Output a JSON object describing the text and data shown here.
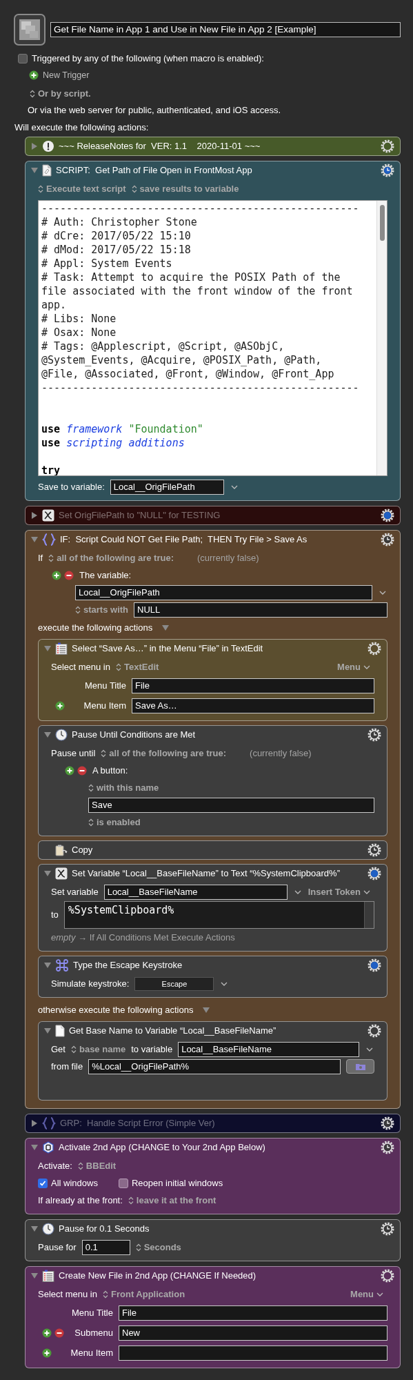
{
  "macro": {
    "title": "Get File Name in App 1 and Use in New File in App 2 [Example]"
  },
  "triggers": {
    "enabled": false,
    "label": "Triggered by any of the following (when macro is enabled):",
    "new_trigger": "New Trigger",
    "script_popup": "Or by script.",
    "web_note": "Or via the web server for public, authenticated, and iOS access."
  },
  "actions_heading": "Will execute the following actions:",
  "actions": [
    {
      "kind": "comment",
      "title": "~~~ ReleaseNotes for  VER: 1.1    2020-11-01 ~~~",
      "color": "#475a29",
      "timeout": false,
      "notify": false,
      "expanded": false,
      "disabled": false
    },
    {
      "kind": "script",
      "title": "SCRIPT:  Get Path of File Open in FrontMost App",
      "color": "#30515a",
      "timeout": true,
      "notify": true,
      "expanded": true,
      "disabled": false,
      "rows": [
        {
          "kind": "line",
          "items": [
            {
              "kind": "popup",
              "text": "Execute text script"
            },
            {
              "kind": "popup",
              "text": "save results to variable"
            }
          ]
        },
        {
          "kind": "code",
          "lines": [
            {
              "kind": "text",
              "tokens": [
                {
                  "kind": "comment",
                  "text": "---------------------------------------------------"
                }
              ]
            },
            {
              "kind": "text",
              "tokens": [
                {
                  "kind": "comment",
                  "text": "# Auth: Christopher Stone"
                }
              ]
            },
            {
              "kind": "text",
              "tokens": [
                {
                  "kind": "comment",
                  "text": "# dCre: 2017/05/22 15:10"
                }
              ]
            },
            {
              "kind": "text",
              "tokens": [
                {
                  "kind": "comment",
                  "text": "# dMod: 2017/05/22 15:18"
                }
              ]
            },
            {
              "kind": "text",
              "tokens": [
                {
                  "kind": "comment",
                  "text": "# Appl: System Events"
                }
              ]
            },
            {
              "kind": "text",
              "tokens": [
                {
                  "kind": "comment",
                  "text": "# Task: Attempt to acquire the POSIX Path of the"
                }
              ]
            },
            {
              "kind": "text",
              "tokens": [
                {
                  "kind": "comment",
                  "text": "file associated with the front window of the front"
                }
              ]
            },
            {
              "kind": "text",
              "tokens": [
                {
                  "kind": "comment",
                  "text": "app."
                }
              ]
            },
            {
              "kind": "text",
              "tokens": [
                {
                  "kind": "comment",
                  "text": "# Libs: None"
                }
              ]
            },
            {
              "kind": "text",
              "tokens": [
                {
                  "kind": "comment",
                  "text": "# Osax: None"
                }
              ]
            },
            {
              "kind": "text",
              "tokens": [
                {
                  "kind": "comment",
                  "text": "# Tags: @Applescript, @Script, @ASObjC,"
                }
              ]
            },
            {
              "kind": "text",
              "tokens": [
                {
                  "kind": "comment",
                  "text": "@System_Events, @Acquire, @POSIX_Path, @Path,"
                }
              ]
            },
            {
              "kind": "text",
              "tokens": [
                {
                  "kind": "comment",
                  "text": "@File, @Associated, @Front, @Window, @Front_App"
                }
              ]
            },
            {
              "kind": "text",
              "tokens": [
                {
                  "kind": "comment",
                  "text": "---------------------------------------------------"
                }
              ]
            },
            {
              "kind": "blank"
            },
            {
              "kind": "blank"
            },
            {
              "kind": "text",
              "tokens": [
                {
                  "kind": "keyword",
                  "text": "use "
                },
                {
                  "kind": "term",
                  "text": "framework "
                },
                {
                  "kind": "string",
                  "text": "\"Foundation\""
                }
              ]
            },
            {
              "kind": "text",
              "tokens": [
                {
                  "kind": "keyword",
                  "text": "use "
                },
                {
                  "kind": "term",
                  "text": "scripting additions"
                }
              ]
            },
            {
              "kind": "blank"
            },
            {
              "kind": "text",
              "tokens": [
                {
                  "kind": "keyword",
                  "text": "try"
                }
              ]
            }
          ]
        },
        {
          "kind": "line",
          "items": [
            {
              "kind": "text",
              "text": "Save to variable:"
            },
            {
              "kind": "short_field",
              "value": "Local__OrigFilePath",
              "menu": true
            }
          ]
        }
      ]
    },
    {
      "kind": "set_variable",
      "title": "Set OrigFilePath to \"NULL\" for TESTING",
      "color": "#2a0c0c",
      "timeout": false,
      "notify": true,
      "expanded": false,
      "disabled": true
    },
    {
      "kind": "if",
      "title": "IF:  Script Could NOT Get File Path;  THEN Try File > Save As",
      "color": "#5c442d",
      "timeout": true,
      "notify": false,
      "expanded": true,
      "disabled": false,
      "rows": [
        {
          "kind": "line",
          "items": [
            {
              "kind": "text",
              "text": "If"
            },
            {
              "kind": "popup",
              "text": "all of the following are true:"
            },
            {
              "kind": "note",
              "text": "(currently false)"
            }
          ]
        },
        {
          "kind": "sub",
          "items": [
            {
              "kind": "addremove"
            },
            {
              "kind": "text",
              "text": "The variable:"
            }
          ]
        },
        {
          "kind": "subsub",
          "items": [
            {
              "kind": "field",
              "value": "Local__OrigFilePath",
              "menu": true
            }
          ]
        },
        {
          "kind": "subsub",
          "items": [
            {
              "kind": "popup",
              "text": "starts with"
            },
            {
              "kind": "field",
              "value": "NULL"
            }
          ]
        },
        {
          "kind": "heading",
          "text": "execute the following actions"
        },
        {
          "kind": "actions",
          "children": [
            {
              "kind": "select_menu",
              "title": "Select “Save As…” in the Menu “File” in TextEdit",
              "color": "#5b4e2f",
              "timeout": false,
              "notify": false,
              "expanded": true,
              "disabled": false,
              "rows": [
                {
                  "kind": "line",
                  "items": [
                    {
                      "kind": "text",
                      "text": "Select menu in"
                    },
                    {
                      "kind": "popup",
                      "text": "TextEdit"
                    },
                    {
                      "kind": "menu",
                      "text": "Menu"
                    }
                  ]
                },
                {
                  "kind": "labeled",
                  "label": "Menu Title",
                  "value": "File",
                  "add": false,
                  "remove": false
                },
                {
                  "kind": "labeled",
                  "label": "Menu Item",
                  "value": "Save As…",
                  "add": true,
                  "remove": false
                }
              ]
            },
            {
              "kind": "pause_until",
              "title": "Pause Until Conditions are Met",
              "color": "#3d3d3d",
              "timeout": true,
              "notify": false,
              "expanded": true,
              "disabled": false,
              "rows": [
                {
                  "kind": "line",
                  "items": [
                    {
                      "kind": "text",
                      "text": "Pause until"
                    },
                    {
                      "kind": "popup",
                      "text": "all of the following are true:"
                    },
                    {
                      "kind": "note",
                      "text": "(currently false)"
                    }
                  ]
                },
                {
                  "kind": "sub",
                  "items": [
                    {
                      "kind": "addremove"
                    },
                    {
                      "kind": "text",
                      "text": "A button:"
                    }
                  ]
                },
                {
                  "kind": "subsub",
                  "items": [
                    {
                      "kind": "popup",
                      "text": "with this name"
                    }
                  ]
                },
                {
                  "kind": "subsub",
                  "items": [
                    {
                      "kind": "field",
                      "value": "Save"
                    }
                  ]
                },
                {
                  "kind": "subsub",
                  "items": [
                    {
                      "kind": "popup",
                      "text": "is enabled"
                    }
                  ]
                }
              ]
            },
            {
              "kind": "copy",
              "title": "Copy",
              "color": "#3d3d3d",
              "timeout": true,
              "notify": false,
              "disabled": false
            },
            {
              "kind": "set_variable",
              "title": "Set Variable “Local__BaseFileName” to Text “%SystemClipboard%”",
              "color": "#3d3d3d",
              "timeout": false,
              "notify": true,
              "expanded": true,
              "disabled": false,
              "rows": [
                {
                  "kind": "line",
                  "items": [
                    {
                      "kind": "text",
                      "text": "Set variable"
                    },
                    {
                      "kind": "field",
                      "value": "Local__BaseFileName",
                      "menu": true
                    },
                    {
                      "kind": "menu",
                      "text": "Insert Token"
                    }
                  ]
                },
                {
                  "kind": "line",
                  "items": [
                    {
                      "kind": "text",
                      "text": "to"
                    },
                    {
                      "kind": "textarea",
                      "value": "%SystemClipboard%"
                    }
                  ]
                },
                {
                  "kind": "line",
                  "items": [
                    {
                      "kind": "note",
                      "text": "*empty* → If All Conditions Met Execute Actions"
                    }
                  ]
                }
              ]
            },
            {
              "kind": "type_keystroke",
              "title": "Type the Escape Keystroke",
              "color": "#3d3d3d",
              "timeout": false,
              "notify": true,
              "expanded": true,
              "disabled": false,
              "rows": [
                {
                  "kind": "line",
                  "items": [
                    {
                      "kind": "text",
                      "text": "Simulate keystroke:"
                    },
                    {
                      "kind": "key",
                      "text": "Escape"
                    }
                  ]
                }
              ]
            }
          ]
        },
        {
          "kind": "heading",
          "text": "otherwise execute the following actions"
        },
        {
          "kind": "actions",
          "children": [
            {
              "kind": "get_file_attribute",
              "title": "Get Base Name to Variable “Local__BaseFileName”",
              "color": "#3d3d3d",
              "timeout": false,
              "notify": false,
              "expanded": true,
              "disabled": false,
              "rows": [
                {
                  "kind": "line",
                  "items": [
                    {
                      "kind": "text",
                      "text": "Get"
                    },
                    {
                      "kind": "popup",
                      "text": "base name"
                    },
                    {
                      "kind": "text",
                      "text": "to variable"
                    },
                    {
                      "kind": "field",
                      "value": "Local__BaseFileName",
                      "menu": true
                    }
                  ]
                },
                {
                  "kind": "line",
                  "items": [
                    {
                      "kind": "text",
                      "text": "from file"
                    },
                    {
                      "kind": "field",
                      "value": "%Local__OrigFilePath%"
                    },
                    {
                      "kind": "file_button"
                    }
                  ]
                },
                {
                  "kind": "spacer"
                }
              ]
            }
          ]
        }
      ]
    },
    {
      "kind": "group",
      "title": "GRP:  Handle Script Error (Simple Ver)",
      "color": "#0d0d2b",
      "timeout": true,
      "notify": false,
      "expanded": false,
      "disabled": true
    },
    {
      "kind": "activate",
      "title": "Activate 2nd App (CHANGE to Your 2nd App Below)",
      "color": "#5a2f5b",
      "timeout": true,
      "notify": false,
      "expanded": true,
      "disabled": false,
      "rows": [
        {
          "kind": "line",
          "items": [
            {
              "kind": "text",
              "text": "Activate:"
            },
            {
              "kind": "popup",
              "text": "BBEdit"
            }
          ]
        },
        {
          "kind": "line",
          "items": [
            {
              "kind": "checkbox",
              "label": "All windows",
              "checked": true
            },
            {
              "kind": "checkbox",
              "label": "Reopen initial windows",
              "checked": false
            }
          ]
        },
        {
          "kind": "line",
          "items": [
            {
              "kind": "text",
              "text": "If already at the front:"
            },
            {
              "kind": "popup",
              "text": "leave it at the front"
            }
          ]
        }
      ]
    },
    {
      "kind": "pause",
      "title": "Pause for 0.1 Seconds",
      "color": "#3d3d3d",
      "timeout": true,
      "notify": false,
      "expanded": true,
      "disabled": false,
      "rows": [
        {
          "kind": "line",
          "items": [
            {
              "kind": "text",
              "text": "Pause for"
            },
            {
              "kind": "tiny_field",
              "value": "0.1"
            },
            {
              "kind": "popup",
              "text": "Seconds"
            }
          ]
        }
      ]
    },
    {
      "kind": "select_menu",
      "title": "Create New File in 2nd App (CHANGE If Needed)",
      "color": "#5a2f5b",
      "timeout": false,
      "notify": false,
      "expanded": true,
      "disabled": false,
      "rows": [
        {
          "kind": "line",
          "items": [
            {
              "kind": "text",
              "text": "Select menu in"
            },
            {
              "kind": "popup",
              "text": "Front Application"
            },
            {
              "kind": "menu",
              "text": "Menu"
            }
          ]
        },
        {
          "kind": "labeled",
          "label": "Menu Title",
          "value": "File",
          "add": false,
          "remove": false
        },
        {
          "kind": "labeled",
          "label": "Submenu",
          "value": "New",
          "add": true,
          "remove": true
        },
        {
          "kind": "labeled",
          "label": "Menu Item",
          "add": true,
          "remove": false
        }
      ]
    }
  ]
}
